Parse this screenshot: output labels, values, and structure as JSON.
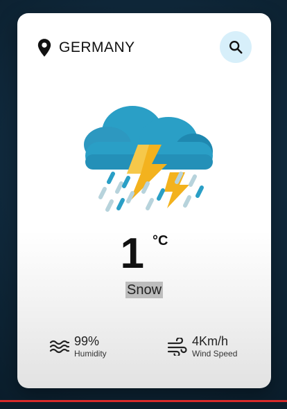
{
  "location": {
    "name": "GERMANY",
    "icon": "map-pin-icon"
  },
  "search": {
    "icon": "search-icon",
    "button_color": "#d7effa"
  },
  "weather": {
    "temperature": "1",
    "unit": "°C",
    "condition": "Snow",
    "illustration": "thunderstorm-rain-icon"
  },
  "stats": {
    "humidity": {
      "value": "99%",
      "label": "Humidity",
      "icon": "humidity-waves-icon"
    },
    "wind": {
      "value": "4Km/h",
      "label": "Wind Speed",
      "icon": "wind-icon"
    }
  },
  "colors": {
    "background": "#0f2a3e",
    "card": "#ffffff",
    "cloud": "#2a9fc6",
    "bolt": "#f3b21e",
    "accent_line": "#d62a2a"
  }
}
